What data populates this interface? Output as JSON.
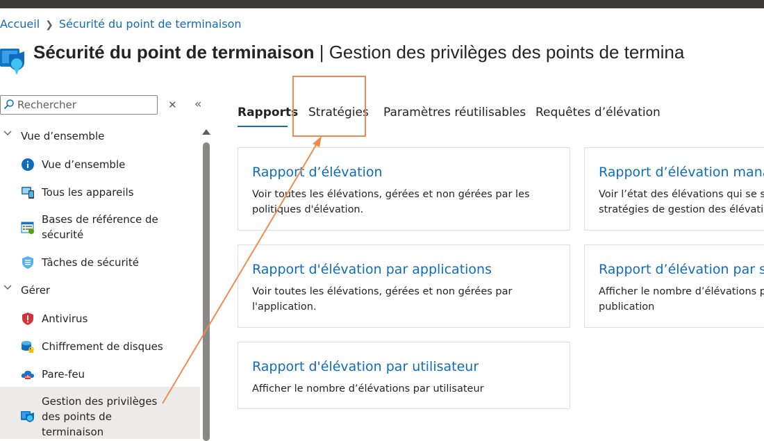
{
  "breadcrumb": {
    "home": "Accueil",
    "current": "Sécurité du point de terminaison"
  },
  "header": {
    "title_bold": "Sécurité du point de terminaison",
    "title_rest": "| Gestion des privilèges des points de termina"
  },
  "search": {
    "placeholder": "Rechercher"
  },
  "sidebar": {
    "groups": [
      "Vue d’ensemble",
      "Gérer"
    ],
    "items": [
      {
        "label": "Vue d’ensemble",
        "icon": "info-icon"
      },
      {
        "label": "Tous les appareils",
        "icon": "devices-icon"
      },
      {
        "label": "Bases de référence de sécurité",
        "icon": "security-baseline-icon"
      },
      {
        "label": "Tâches de sécurité",
        "icon": "shield-tasks-icon"
      },
      {
        "label": "Antivirus",
        "icon": "antivirus-shield-icon"
      },
      {
        "label": "Chiffrement de disques",
        "icon": "disk-encryption-icon"
      },
      {
        "label": "Pare-feu",
        "icon": "firewall-cloud-icon"
      },
      {
        "label": "Gestion des privilèges des points de terminaison",
        "icon": "privilege-management-icon"
      }
    ]
  },
  "tabs": [
    "Rapports",
    "Stratégies",
    "Paramètres réutilisables",
    "Requêtes d’élévation"
  ],
  "active_tab": "Rapports",
  "cards": [
    {
      "title": "Rapport d’élévation",
      "desc": "Voir toutes les élévations, gérées et non gérées par les politiques d'élévation."
    },
    {
      "title": "Rapport d’élévation manag",
      "desc": "Voir l’état des élévations qui se sou stratégies de gestion des élévation"
    },
    {
      "title": "Rapport d'élévation par applications",
      "desc": "Voir toutes les élévations, gérées et non gérées par l'application."
    },
    {
      "title": "Rapport d’élévation par ser",
      "desc": "Afficher le nombre d’élévations p publication"
    },
    {
      "title": "Rapport d'élévation par utilisateur",
      "desc": "Afficher le nombre d’élévations par utilisateur"
    }
  ],
  "colors": {
    "accent": "#0f6cbd",
    "annotation": "#ef8a4d",
    "selected_bg": "#edebe9"
  }
}
